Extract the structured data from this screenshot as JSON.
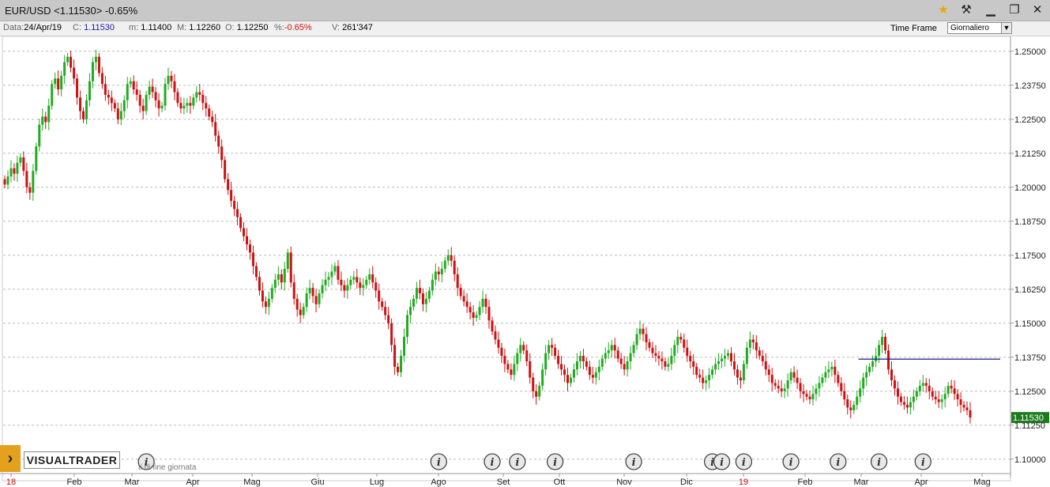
{
  "window": {
    "title": "EUR/USD <1.11530> -0.65%",
    "buttons": [
      "star-icon",
      "hammer-icon",
      "minimize-icon",
      "maximize-icon",
      "close-icon"
    ]
  },
  "info_bar": {
    "data_label": "Data:",
    "data_value": "24/Apr/19",
    "c_label": "C:",
    "c_value": "1.11530",
    "m_label": "m:",
    "m_value": "1.11400",
    "M_label": "M:",
    "M_value": "1.12260",
    "o_label": "O:",
    "o_value": "1.12250",
    "pct_label": "%:",
    "pct_value": "-0.65%",
    "v_label": "V:",
    "v_value": "261'347"
  },
  "time_frame": {
    "label": "Time Frame",
    "value": "Giornaliero"
  },
  "logo": {
    "text": "VISUALTRADER",
    "subtext": "ti di fine giornata"
  },
  "colors": {
    "up": "#22aa22",
    "down": "#cc1111",
    "support_line": "#1a1a8c",
    "price_tag": "#1e7a1e",
    "grid": "#bbbbbb"
  },
  "chart_data": {
    "type": "candlestick",
    "symbol": "EUR/USD",
    "ylim": [
      1.095,
      1.2555
    ],
    "y_ticks": [
      "1.10000",
      "1.11250",
      "1.12500",
      "1.13750",
      "1.15000",
      "1.16250",
      "1.17500",
      "1.18750",
      "1.20000",
      "1.21250",
      "1.22500",
      "1.23750",
      "1.25000"
    ],
    "x_ticks": [
      "18",
      "Feb",
      "Mar",
      "Apr",
      "Mag",
      "Giu",
      "Lug",
      "Ago",
      "Set",
      "Ott",
      "Nov",
      "Dic",
      "19",
      "Feb",
      "Mar",
      "Apr",
      "Mag"
    ],
    "last_price": "1.11530",
    "support_line": {
      "y": 1.1368,
      "x_from_index": 279,
      "x_to_index": 325
    },
    "info_markers_at_index": [
      45,
      138,
      155,
      163,
      175,
      200,
      225,
      228,
      235,
      250,
      265,
      278,
      292
    ],
    "grid": true,
    "close_values": [
      1.201,
      1.204,
      1.207,
      1.205,
      1.209,
      1.211,
      1.206,
      1.2,
      1.198,
      1.206,
      1.215,
      1.223,
      1.226,
      1.224,
      1.23,
      1.238,
      1.24,
      1.236,
      1.241,
      1.246,
      1.248,
      1.244,
      1.24,
      1.233,
      1.228,
      1.225,
      1.232,
      1.239,
      1.246,
      1.248,
      1.242,
      1.238,
      1.234,
      1.233,
      1.231,
      1.229,
      1.225,
      1.228,
      1.232,
      1.238,
      1.239,
      1.236,
      1.234,
      1.23,
      1.228,
      1.234,
      1.237,
      1.235,
      1.232,
      1.229,
      1.23,
      1.238,
      1.241,
      1.239,
      1.235,
      1.231,
      1.229,
      1.23,
      1.231,
      1.23,
      1.233,
      1.235,
      1.234,
      1.231,
      1.229,
      1.226,
      1.224,
      1.219,
      1.215,
      1.21,
      1.203,
      1.199,
      1.195,
      1.192,
      1.189,
      1.185,
      1.182,
      1.179,
      1.176,
      1.171,
      1.167,
      1.162,
      1.158,
      1.156,
      1.159,
      1.163,
      1.166,
      1.168,
      1.165,
      1.17,
      1.176,
      1.165,
      1.159,
      1.155,
      1.153,
      1.156,
      1.161,
      1.163,
      1.16,
      1.157,
      1.161,
      1.164,
      1.166,
      1.167,
      1.169,
      1.171,
      1.166,
      1.164,
      1.162,
      1.164,
      1.166,
      1.167,
      1.165,
      1.163,
      1.164,
      1.166,
      1.168,
      1.165,
      1.162,
      1.158,
      1.156,
      1.153,
      1.15,
      1.142,
      1.134,
      1.132,
      1.138,
      1.145,
      1.153,
      1.156,
      1.159,
      1.163,
      1.161,
      1.157,
      1.159,
      1.162,
      1.166,
      1.169,
      1.168,
      1.17,
      1.173,
      1.175,
      1.173,
      1.168,
      1.163,
      1.16,
      1.158,
      1.156,
      1.154,
      1.152,
      1.153,
      1.156,
      1.159,
      1.156,
      1.151,
      1.147,
      1.144,
      1.141,
      1.138,
      1.135,
      1.133,
      1.131,
      1.135,
      1.139,
      1.142,
      1.14,
      1.136,
      1.13,
      1.125,
      1.123,
      1.127,
      1.133,
      1.139,
      1.142,
      1.141,
      1.138,
      1.135,
      1.133,
      1.131,
      1.128,
      1.13,
      1.133,
      1.136,
      1.138,
      1.136,
      1.134,
      1.131,
      1.13,
      1.132,
      1.134,
      1.137,
      1.139,
      1.14,
      1.142,
      1.14,
      1.137,
      1.135,
      1.133,
      1.136,
      1.139,
      1.142,
      1.146,
      1.148,
      1.146,
      1.143,
      1.141,
      1.139,
      1.138,
      1.137,
      1.136,
      1.134,
      1.135,
      1.138,
      1.142,
      1.145,
      1.144,
      1.141,
      1.138,
      1.136,
      1.134,
      1.131,
      1.13,
      1.128,
      1.129,
      1.131,
      1.133,
      1.135,
      1.136,
      1.137,
      1.138,
      1.139,
      1.136,
      1.133,
      1.13,
      1.129,
      1.135,
      1.141,
      1.144,
      1.143,
      1.14,
      1.138,
      1.136,
      1.133,
      1.131,
      1.128,
      1.127,
      1.126,
      1.125,
      1.126,
      1.129,
      1.132,
      1.13,
      1.128,
      1.125,
      1.124,
      1.123,
      1.122,
      1.124,
      1.126,
      1.128,
      1.13,
      1.132,
      1.133,
      1.134,
      1.131,
      1.128,
      1.125,
      1.122,
      1.119,
      1.118,
      1.12,
      1.123,
      1.126,
      1.13,
      1.132,
      1.134,
      1.136,
      1.138,
      1.142,
      1.145,
      1.14,
      1.133,
      1.129,
      1.126,
      1.123,
      1.121,
      1.12,
      1.119,
      1.121,
      1.123,
      1.125,
      1.127,
      1.128,
      1.127,
      1.125,
      1.123,
      1.122,
      1.121,
      1.122,
      1.124,
      1.127,
      1.126,
      1.124,
      1.122,
      1.12,
      1.119,
      1.118,
      1.1153
    ]
  }
}
